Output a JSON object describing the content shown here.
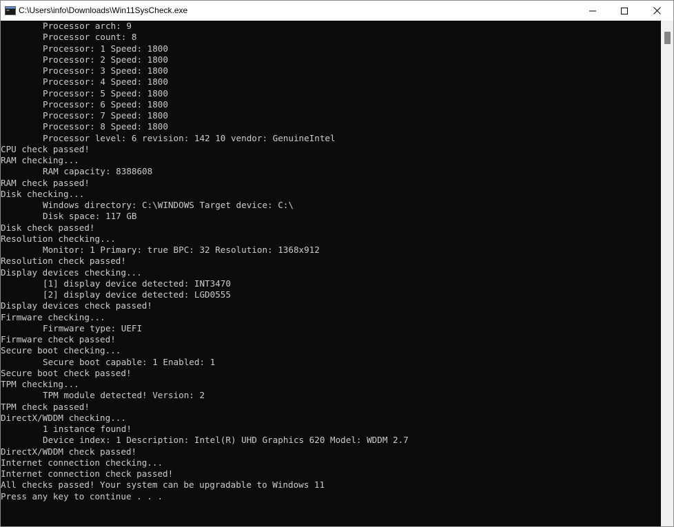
{
  "window": {
    "title": "C:\\Users\\info\\Downloads\\Win11SysCheck.exe",
    "app_icon": "console-app-icon",
    "buttons": {
      "minimize_icon": "minimize-icon",
      "maximize_icon": "maximize-icon",
      "close_icon": "close-icon"
    }
  },
  "console": {
    "text_color": "#cccccc",
    "background": "#0c0c0c",
    "lines": [
      {
        "text": "Processor arch: 9",
        "indent": true
      },
      {
        "text": "Processor count: 8",
        "indent": true
      },
      {
        "text": "Processor: 1 Speed: 1800",
        "indent": true
      },
      {
        "text": "Processor: 2 Speed: 1800",
        "indent": true
      },
      {
        "text": "Processor: 3 Speed: 1800",
        "indent": true
      },
      {
        "text": "Processor: 4 Speed: 1800",
        "indent": true
      },
      {
        "text": "Processor: 5 Speed: 1800",
        "indent": true
      },
      {
        "text": "Processor: 6 Speed: 1800",
        "indent": true
      },
      {
        "text": "Processor: 7 Speed: 1800",
        "indent": true
      },
      {
        "text": "Processor: 8 Speed: 1800",
        "indent": true
      },
      {
        "text": "Processor level: 6 revision: 142 10 vendor: GenuineIntel",
        "indent": true
      },
      {
        "text": "CPU check passed!",
        "indent": false
      },
      {
        "text": "RAM checking...",
        "indent": false
      },
      {
        "text": "RAM capacity: 8388608",
        "indent": true
      },
      {
        "text": "RAM check passed!",
        "indent": false
      },
      {
        "text": "Disk checking...",
        "indent": false
      },
      {
        "text": "Windows directory: C:\\WINDOWS Target device: C:\\",
        "indent": true
      },
      {
        "text": "Disk space: 117 GB",
        "indent": true
      },
      {
        "text": "Disk check passed!",
        "indent": false
      },
      {
        "text": "Resolution checking...",
        "indent": false
      },
      {
        "text": "Monitor: 1 Primary: true BPC: 32 Resolution: 1368x912",
        "indent": true
      },
      {
        "text": "Resolution check passed!",
        "indent": false
      },
      {
        "text": "Display devices checking...",
        "indent": false
      },
      {
        "text": "[1] display device detected: INT3470",
        "indent": true
      },
      {
        "text": "[2] display device detected: LGD0555",
        "indent": true
      },
      {
        "text": "Display devices check passed!",
        "indent": false
      },
      {
        "text": "Firmware checking...",
        "indent": false
      },
      {
        "text": "Firmware type: UEFI",
        "indent": true
      },
      {
        "text": "Firmware check passed!",
        "indent": false
      },
      {
        "text": "Secure boot checking...",
        "indent": false
      },
      {
        "text": "Secure boot capable: 1 Enabled: 1",
        "indent": true
      },
      {
        "text": "Secure boot check passed!",
        "indent": false
      },
      {
        "text": "TPM checking...",
        "indent": false
      },
      {
        "text": "TPM module detected! Version: 2",
        "indent": true
      },
      {
        "text": "TPM check passed!",
        "indent": false
      },
      {
        "text": "DirectX/WDDM checking...",
        "indent": false
      },
      {
        "text": "1 instance found!",
        "indent": true
      },
      {
        "text": "Device index: 1 Description: Intel(R) UHD Graphics 620 Model: WDDM 2.7",
        "indent": true
      },
      {
        "text": "DirectX/WDDM check passed!",
        "indent": false
      },
      {
        "text": "Internet connection checking...",
        "indent": false
      },
      {
        "text": "Internet connection check passed!",
        "indent": false
      },
      {
        "text": "All checks passed! Your system can be upgradable to Windows 11",
        "indent": false
      },
      {
        "text": "Press any key to continue . . .",
        "indent": false
      }
    ]
  }
}
